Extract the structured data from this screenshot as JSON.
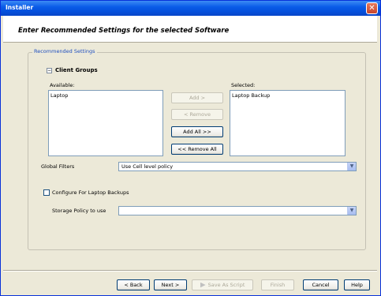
{
  "window": {
    "title": "Installer",
    "close_symbol": "✕"
  },
  "header": {
    "title": "Enter Recommended Settings for the selected Software"
  },
  "recommended_settings": {
    "legend": "Recommended Settings",
    "client_groups": {
      "title": "Client Groups",
      "collapse_symbol": "−",
      "available_label": "Available:",
      "selected_label": "Selected:",
      "available_items": [
        "Laptop"
      ],
      "selected_items": [
        "Laptop Backup"
      ],
      "buttons": {
        "add": "Add >",
        "remove": "< Remove",
        "add_all": "Add All >>",
        "remove_all": "<< Remove All"
      }
    },
    "global_filters": {
      "label": "Global Filters",
      "value": "Use Cell level policy"
    },
    "laptop_backups": {
      "checkbox_label": "Configure For Laptop Backups",
      "checked": false
    },
    "storage_policy": {
      "label": "Storage Policy to use",
      "value": ""
    }
  },
  "footer": {
    "back": "< Back",
    "next": "Next >",
    "save_script": "Save As Script",
    "finish": "Finish",
    "cancel": "Cancel",
    "help": "Help"
  },
  "icons": {
    "dropdown": "▼"
  }
}
